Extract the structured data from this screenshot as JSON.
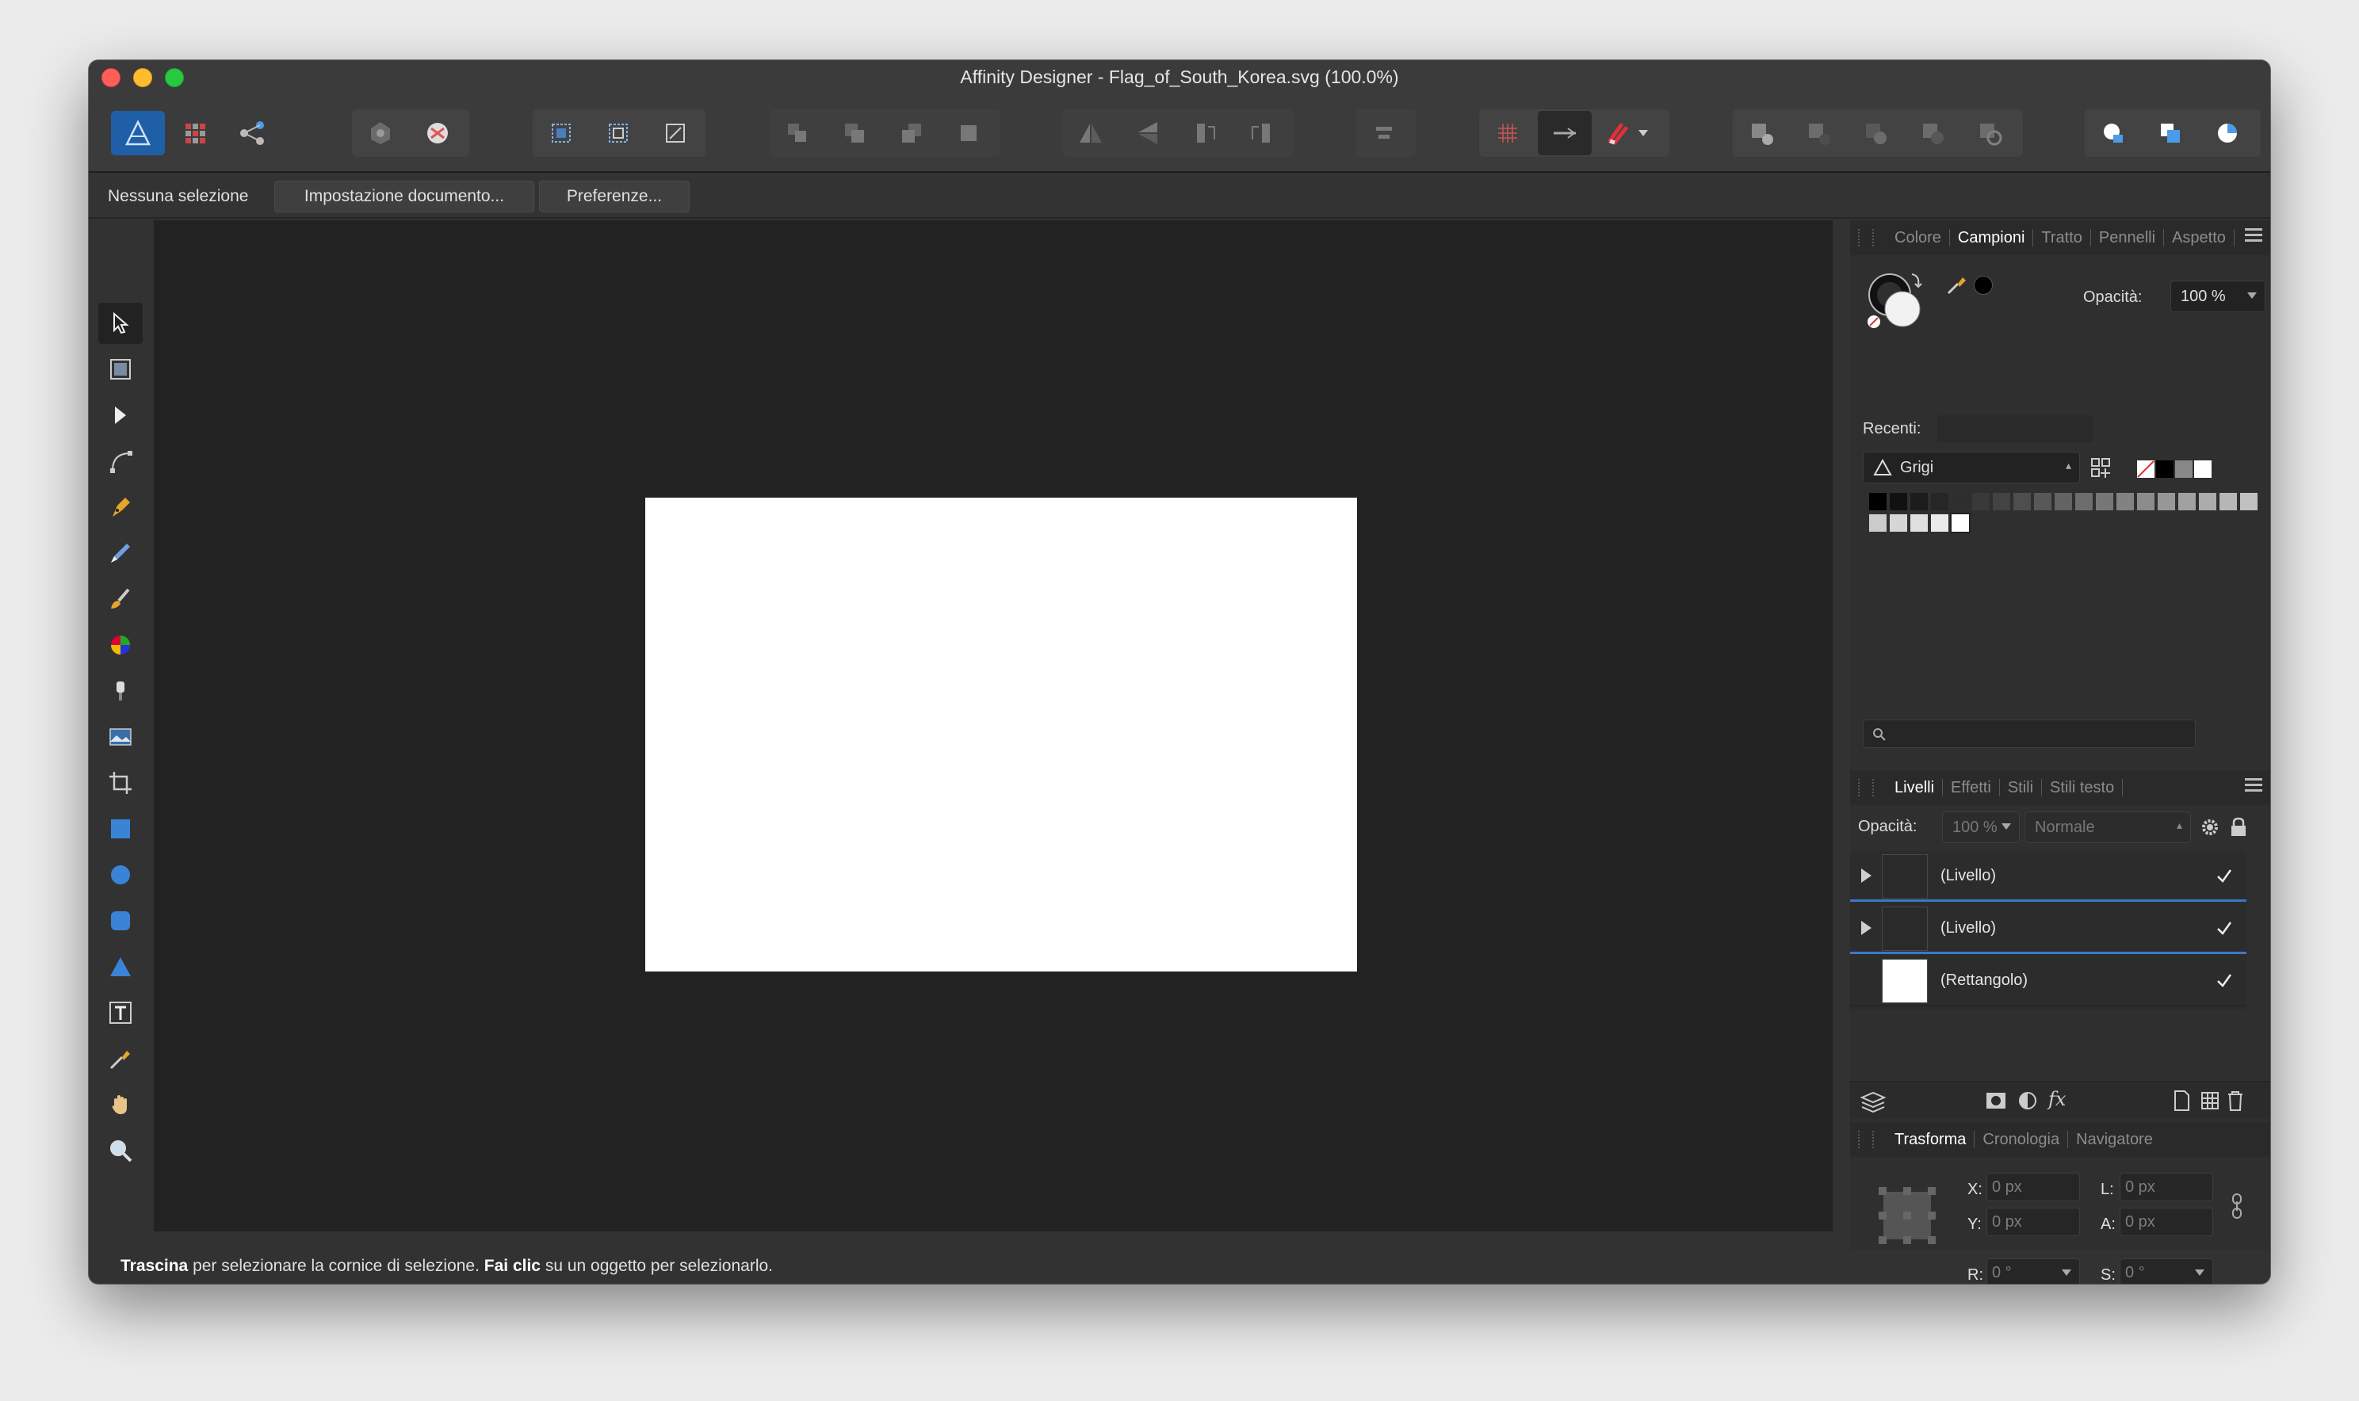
{
  "window": {
    "title": "Affinity Designer - Flag_of_South_Korea.svg (100.0%)"
  },
  "toolbar": {
    "groups": [
      {
        "name": "personas",
        "buttons": [
          "designer-persona-icon",
          "pixel-persona-icon",
          "export-persona-icon"
        ]
      },
      {
        "name": "quick-actions",
        "buttons": [
          "assistant-icon",
          "snap-to-pixel-icon"
        ]
      },
      {
        "name": "selection-box",
        "buttons": [
          "select-bounds-icon",
          "select-shape-icon",
          "transform-origin-icon"
        ]
      },
      {
        "name": "arrange",
        "buttons": [
          "move-to-back-icon",
          "move-back-icon",
          "move-forward-icon",
          "move-to-front-icon"
        ]
      },
      {
        "name": "flip-rotate",
        "buttons": [
          "flip-horizontal-icon",
          "flip-vertical-icon",
          "rotate-left-icon",
          "rotate-right-icon"
        ]
      },
      {
        "name": "align",
        "buttons": [
          "align-icon"
        ]
      },
      {
        "name": "snapping",
        "buttons": [
          "grid-icon",
          "baseline-icon",
          "magnet-snap-icon"
        ]
      },
      {
        "name": "boolean",
        "buttons": [
          "add-icon",
          "subtract-icon",
          "intersect-icon",
          "xor-icon",
          "divide-icon"
        ]
      },
      {
        "name": "panels",
        "buttons": [
          "insert-inside-icon",
          "insert-behind-icon",
          "insert-top-icon"
        ]
      }
    ]
  },
  "context_bar": {
    "selection_label": "Nessuna selezione",
    "document_setup": "Impostazione documento...",
    "preferences": "Preferenze..."
  },
  "tools": [
    "move-tool",
    "artboard-tool",
    "node-tool",
    "corner-tool",
    "pen-tool",
    "pencil-tool",
    "vector-brush-tool",
    "fill-tool",
    "transparency-tool",
    "place-image-tool",
    "crop-tool",
    "rectangle-tool",
    "ellipse-tool",
    "rounded-rectangle-tool",
    "triangle-tool",
    "text-tool",
    "color-picker-tool",
    "view-tool",
    "zoom-tool"
  ],
  "swatches_panel": {
    "tabs": [
      "Colore",
      "Campioni",
      "Tratto",
      "Pennelli",
      "Aspetto"
    ],
    "active_tab": "Campioni",
    "opacity_label": "Opacità:",
    "opacity_value": "100 %",
    "recents_label": "Recenti:",
    "palette_value": "Grigi",
    "gray_swatches": [
      "#000000",
      "#111111",
      "#1c1c1c",
      "#262626",
      "#2e2e2e",
      "#393939",
      "#434343",
      "#4e4e4e",
      "#585858",
      "#636363",
      "#6d6d6d",
      "#777777",
      "#828282",
      "#8c8c8c",
      "#979797",
      "#a1a1a1",
      "#acacac",
      "#b6b6b6",
      "#c1c1c1",
      "#cbcbcb",
      "#d6d6d6",
      "#e0e0e0",
      "#ebebeb",
      "#ffffff"
    ]
  },
  "layers_panel": {
    "tabs": [
      "Livelli",
      "Effetti",
      "Stili",
      "Stili testo"
    ],
    "active_tab": "Livelli",
    "opacity_label": "Opacità:",
    "opacity_value": "100 %",
    "blend_mode": "Normale",
    "layers": [
      {
        "name": "(Livello)",
        "expandable": true,
        "visible": true
      },
      {
        "name": "(Livello)",
        "expandable": true,
        "visible": true
      },
      {
        "name": "(Rettangolo)",
        "expandable": false,
        "visible": true
      }
    ]
  },
  "transform_panel": {
    "tabs": [
      "Trasforma",
      "Cronologia",
      "Navigatore"
    ],
    "active_tab": "Trasforma",
    "x_label": "X:",
    "x_value": "0 px",
    "y_label": "Y:",
    "y_value": "0 px",
    "w_label": "L:",
    "w_value": "0 px",
    "h_label": "A:",
    "h_value": "0 px",
    "r_label": "R:",
    "r_value": "0 °",
    "s_label": "S:",
    "s_value": "0 °"
  },
  "status_bar": {
    "drag_bold": "Trascina",
    "drag_text": " per selezionare la cornice di selezione. ",
    "click_bold": "Fai clic",
    "click_text": " su un oggetto per selezionarlo."
  },
  "colors": {
    "accent": "#3b78c9",
    "canvas_bg": "#222222",
    "artboard": "#ffffff"
  }
}
